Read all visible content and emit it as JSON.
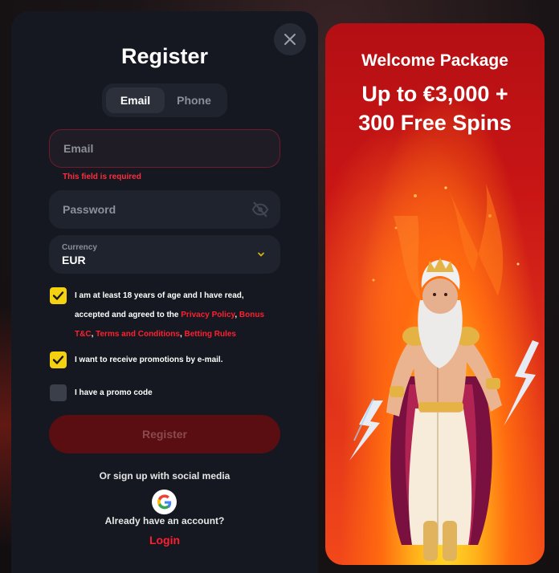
{
  "modal": {
    "close_icon": "close-icon",
    "title": "Register",
    "tabs": [
      {
        "label": "Email",
        "active": true
      },
      {
        "label": "Phone",
        "active": false
      }
    ],
    "email": {
      "placeholder": "Email",
      "value": "",
      "error": "This field is required"
    },
    "password": {
      "placeholder": "Password",
      "value": "",
      "icon": "eye-off-icon"
    },
    "currency": {
      "label": "Currency",
      "value": "EUR",
      "icon": "chevron-down-icon"
    },
    "checks": {
      "age": {
        "checked": true,
        "text_before": "I am at least 18 years of age and I have read, accepted and agreed to the ",
        "link1": "Privacy Policy",
        "sep1": ", ",
        "link2": "Bonus T&C",
        "sep2": ", ",
        "link3": "Terms and Conditions",
        "sep3": ", ",
        "link4": "Betting Rules"
      },
      "promotions": {
        "checked": true,
        "text": "I want to receive promotions by e-mail."
      },
      "promo_code": {
        "checked": false,
        "text": "I have a promo code"
      }
    },
    "register_button": "Register",
    "social_text": "Or sign up with social media",
    "social_icon": "google-icon",
    "have_account_text": "Already have an account?",
    "login_link": "Login"
  },
  "promo": {
    "headline": "Welcome Package",
    "offer_line1": "Up to €3,000 +",
    "offer_line2": "300 Free Spins"
  },
  "colors": {
    "panel": "#151821",
    "field": "#1f232d",
    "accent_red": "#ff1f2e",
    "checkbox_yellow": "#f5d20f",
    "register_button": "#5a0e12"
  }
}
